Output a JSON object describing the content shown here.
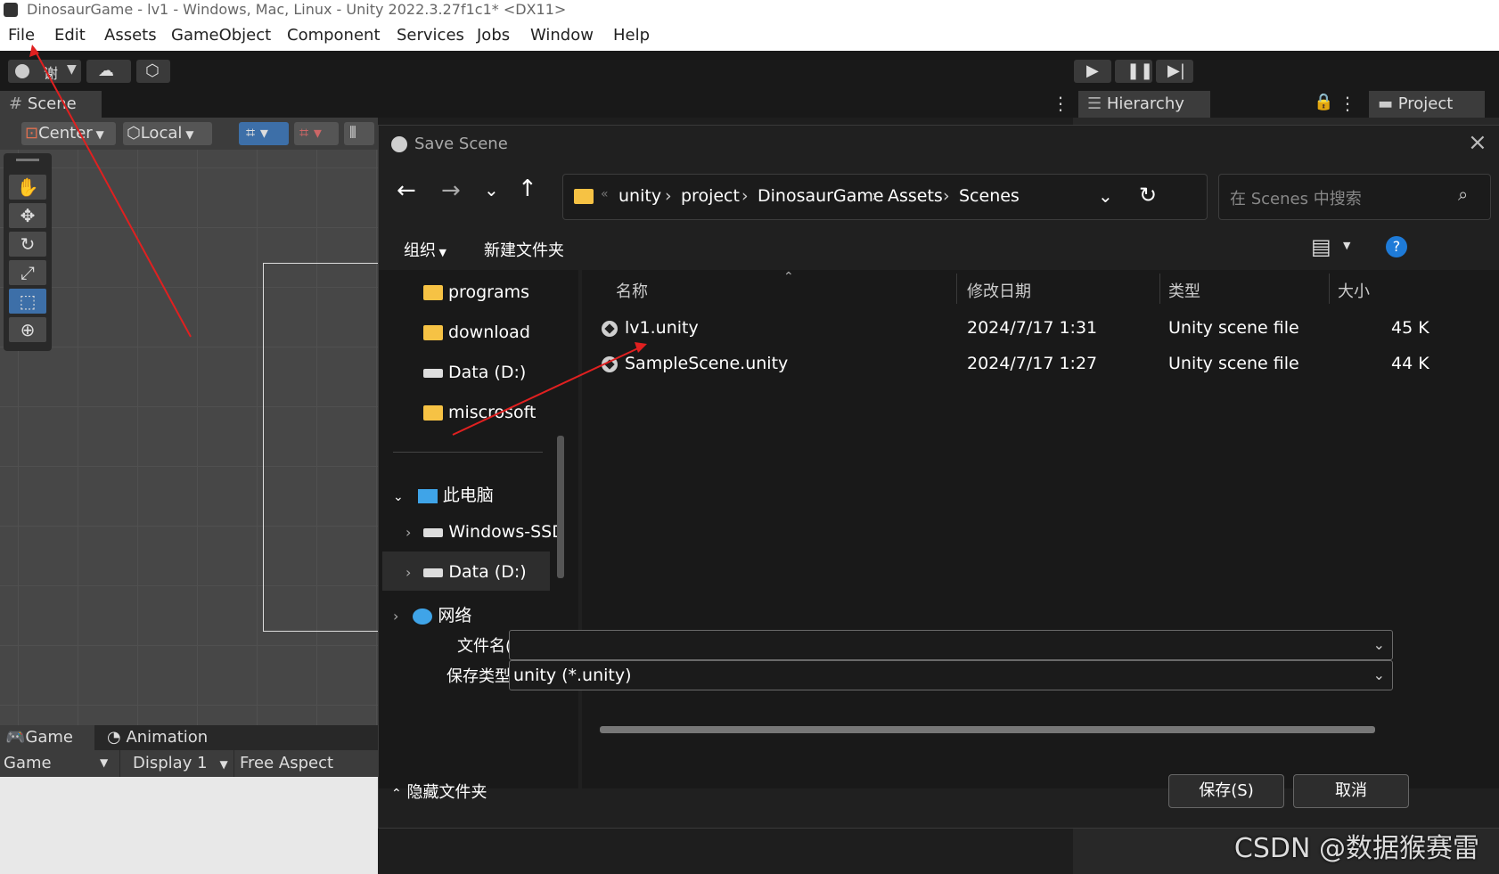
{
  "window": {
    "title": "DinosaurGame - lv1 - Windows, Mac, Linux - Unity 2022.3.27f1c1* <DX11>"
  },
  "menu": [
    "File",
    "Edit",
    "Assets",
    "GameObject",
    "Component",
    "Services",
    "Jobs",
    "Window",
    "Help"
  ],
  "toolbar": {
    "account_label": "谢"
  },
  "tabs": {
    "scene": "Scene",
    "hierarchy": "Hierarchy",
    "project": "Project"
  },
  "scene_toolbar": {
    "pivot": "Center",
    "space": "Local"
  },
  "game_tabs": {
    "game": "Game",
    "animation": "Animation"
  },
  "game_options": {
    "mode": "Game",
    "display": "Display 1",
    "aspect": "Free Aspect"
  },
  "dialog": {
    "title": "Save Scene",
    "breadcrumbs": [
      "unity",
      "project",
      "DinosaurGame",
      "Assets",
      "Scenes"
    ],
    "search_placeholder": "在 Scenes 中搜索",
    "organize": "组织",
    "new_folder": "新建文件夹",
    "nav_items": [
      {
        "label": "programs",
        "icon": "folder-icon"
      },
      {
        "label": "download",
        "icon": "folder-icon"
      },
      {
        "label": "Data (D:)",
        "icon": "drive-icon"
      },
      {
        "label": "miscrosoft",
        "icon": "folder-icon"
      }
    ],
    "nav_tree": [
      {
        "label": "此电脑",
        "icon": "pc-icon"
      },
      {
        "label": "Windows-SSD",
        "icon": "drive-icon"
      },
      {
        "label": "Data (D:)",
        "icon": "drive-icon"
      },
      {
        "label": "网络",
        "icon": "network-icon"
      }
    ],
    "columns": [
      "名称",
      "修改日期",
      "类型",
      "大小"
    ],
    "files": [
      {
        "name": "lv1.unity",
        "date": "2024/7/17 1:31",
        "type": "Unity scene file",
        "size": "45 K"
      },
      {
        "name": "SampleScene.unity",
        "date": "2024/7/17 1:27",
        "type": "Unity scene file",
        "size": "44 K"
      }
    ],
    "filename_label": "文件名(N):",
    "filename_value": "",
    "filetype_label": "保存类型(T):",
    "filetype_value": "unity (*.unity)",
    "hide_folders": "隐藏文件夹",
    "save": "保存(S)",
    "cancel": "取消"
  },
  "watermark": "CSDN @数据猴赛雷",
  "colors": {
    "annotation": "#e02020",
    "help": "#1e7bd8"
  }
}
